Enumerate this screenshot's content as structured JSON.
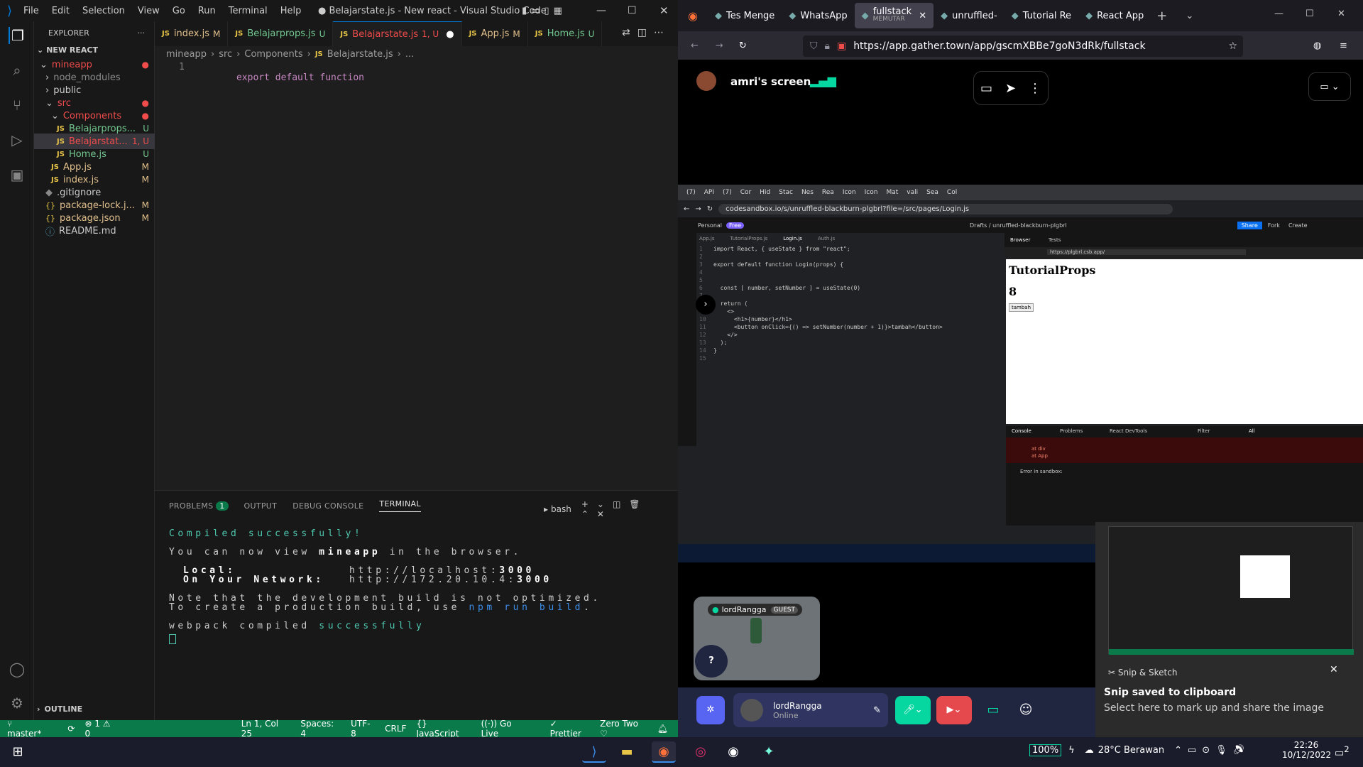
{
  "vscode": {
    "window_title": "● Belajarstate.js - New react - Visual Studio Code",
    "menu": [
      "File",
      "Edit",
      "Selection",
      "View",
      "Go",
      "Run",
      "Terminal",
      "Help"
    ],
    "explorer_title": "EXPLORER",
    "project": "NEW REACT",
    "tree": [
      {
        "label": "mineapp",
        "type": "folder-open",
        "depth": 1,
        "color": "#f14c4c",
        "badge": "●"
      },
      {
        "label": "node_modules",
        "type": "folder",
        "depth": 2,
        "color": "#8c8c8c",
        "badge": ""
      },
      {
        "label": "public",
        "type": "folder",
        "depth": 2,
        "color": "#ccc",
        "badge": ""
      },
      {
        "label": "src",
        "type": "folder-open",
        "depth": 2,
        "color": "#f14c4c",
        "badge": "●"
      },
      {
        "label": "Components",
        "type": "folder-open",
        "depth": 3,
        "color": "#f14c4c",
        "badge": "●"
      },
      {
        "label": "Belajarprops...",
        "type": "js",
        "depth": 4,
        "color": "#73c991",
        "badge": "U"
      },
      {
        "label": "Belajarstat...",
        "type": "js",
        "depth": 4,
        "color": "#f14c4c",
        "badge": "1, U",
        "selected": true
      },
      {
        "label": "Home.js",
        "type": "js",
        "depth": 4,
        "color": "#73c991",
        "badge": "U"
      },
      {
        "label": "App.js",
        "type": "js",
        "depth": 3,
        "color": "#e2c08d",
        "badge": "M"
      },
      {
        "label": "index.js",
        "type": "js",
        "depth": 3,
        "color": "#e2c08d",
        "badge": "M"
      },
      {
        "label": ".gitignore",
        "type": "git",
        "depth": 2,
        "color": "#ccc",
        "badge": ""
      },
      {
        "label": "package-lock.j...",
        "type": "json",
        "depth": 2,
        "color": "#e2c08d",
        "badge": "M"
      },
      {
        "label": "package.json",
        "type": "json",
        "depth": 2,
        "color": "#e2c08d",
        "badge": "M"
      },
      {
        "label": "README.md",
        "type": "info",
        "depth": 2,
        "color": "#ccc",
        "badge": ""
      }
    ],
    "outline": "OUTLINE",
    "tabs": [
      {
        "label": "index.js",
        "badge": "M",
        "color": "#e2c08d"
      },
      {
        "label": "Belajarprops.js",
        "badge": "U",
        "color": "#73c991"
      },
      {
        "label": "Belajarstate.js",
        "badge": "1, U",
        "color": "#f14c4c",
        "active": true
      },
      {
        "label": "App.js",
        "badge": "M",
        "color": "#e2c08d"
      },
      {
        "label": "Home.js",
        "badge": "U",
        "color": "#73c991"
      }
    ],
    "breadcrumb": [
      "mineapp",
      "src",
      "Components",
      "Belajarstate.js",
      "..."
    ],
    "code_line_number": "1",
    "code_line": "export default function ",
    "panel_tabs": [
      "PROBLEMS",
      "OUTPUT",
      "DEBUG CONSOLE",
      "TERMINAL"
    ],
    "problems_count": "1",
    "shell": "bash",
    "terminal": {
      "compiled": "Compiled successfully!",
      "view_prefix": "You can now view ",
      "app": "mineapp",
      "view_suffix": " in the browser.",
      "local_label": "Local:",
      "local_url": "http://localhost:",
      "local_port": "3000",
      "network_label": "On Your Network:",
      "network_url": "http://172.20.10.4:",
      "network_port": "3000",
      "note1": "Note that the development build is not optimized.",
      "note2_prefix": "To create a production build, use ",
      "note2_cmd": "npm run build",
      "note2_suffix": ".",
      "webpack_prefix": "webpack compiled ",
      "webpack_ok": "successfully"
    },
    "status": {
      "branch": "master*",
      "errors": "⊗ 1 ⚠ 0",
      "position": "Ln 1, Col 25",
      "spaces": "Spaces: 4",
      "encoding": "UTF-8",
      "eol": "CRLF",
      "language": "{} JavaScript",
      "golive": "Go Live",
      "prettier": "✓ Prettier",
      "theme": "Zero Two ♡"
    }
  },
  "firefox": {
    "tabs": [
      {
        "label": "Tes Menge"
      },
      {
        "label": "WhatsApp"
      },
      {
        "label": "fullstack",
        "sub": "MEMUTAR",
        "active": true
      },
      {
        "label": "unruffled-"
      },
      {
        "label": "Tutorial Re"
      },
      {
        "label": "React App"
      }
    ],
    "url": "https://app.gather.town/app/gscmXBBe7goN3dRk/fullstack",
    "screen_owner": "amri's screen"
  },
  "shared": {
    "tabs": [
      "(7)",
      "API",
      "(7)",
      "Cor",
      "Hid",
      "Stac",
      "Nes",
      "Rea",
      "Icon",
      "Icon",
      "Mat",
      "vali",
      "Sea",
      "Col"
    ],
    "url": "codesandbox.io/s/unruffled-blackburn-plgbrl?file=/src/pages/Login.js",
    "workspace": "Personal",
    "plan": "Free",
    "drafts": "Drafts / unruffled-blackburn-plgbrl",
    "buttons": [
      "Share",
      "Fork",
      "Create"
    ],
    "file_tabs": [
      "App.js",
      "TutorialProps.js",
      "Login.js",
      "Auth.js"
    ],
    "code": [
      "import React, { useState } from \"react\";",
      "",
      "export default function Login(props) {",
      "",
      "",
      "  const [ number, setNumber ] = useState(0)",
      "",
      "  return (",
      "    <>",
      "      <h1>{number}</h1>",
      "      <button onClick={() => setNumber(number + 1)}>tambah</button>",
      "    </>",
      "  );",
      "}",
      ""
    ],
    "preview_tabs": [
      "Browser",
      "Tests"
    ],
    "preview_url": "https://plgbrl.csb.app/",
    "preview_title": "TutorialProps",
    "preview_number": "8",
    "preview_button": "tambah",
    "console_tabs": [
      "Console",
      "Problems",
      "React DevTools"
    ],
    "console_filter": "Filter",
    "console_all": "All",
    "console_lines": [
      "at div",
      "at App"
    ],
    "console_error": "Error in sandbox:"
  },
  "gather": {
    "player": "lordRangga",
    "guest": "GUEST",
    "status": "Online",
    "help": "?"
  },
  "toast": {
    "app": "Snip & Sketch",
    "title": "Snip saved to clipboard",
    "body": "Select here to mark up and share the image"
  },
  "taskbar": {
    "battery": "100%",
    "weather": "28°C  Berawan",
    "time": "22:26",
    "date": "10/12/2022",
    "notifications": "2"
  },
  "colors": {
    "accent": "#0078d4",
    "status": "#0a7a4a",
    "error": "#f14c4c",
    "untracked": "#73c991",
    "modified": "#e2c08d",
    "terminal": "#4ec9b0"
  }
}
